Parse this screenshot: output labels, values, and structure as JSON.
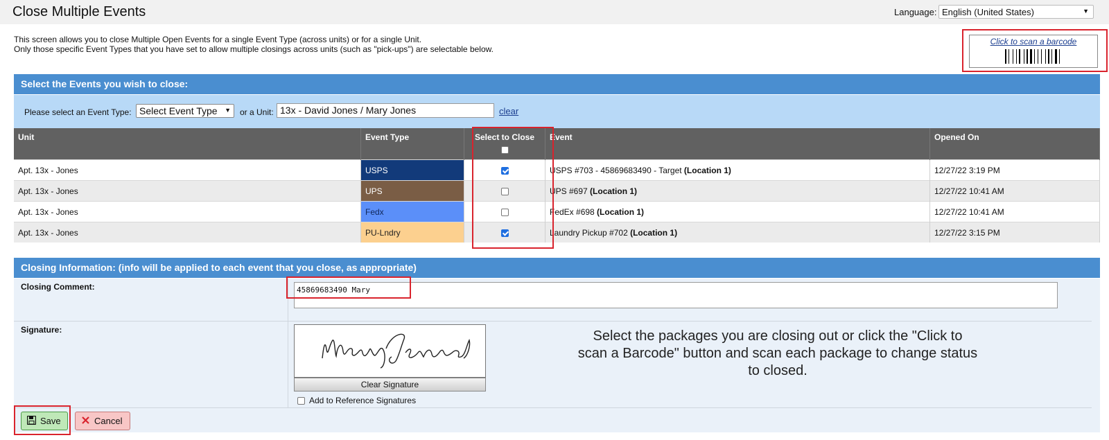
{
  "header": {
    "title": "Close Multiple Events",
    "language_label": "Language:",
    "language_value": "English (United States)"
  },
  "intro": {
    "line1": "This screen allows you to close Multiple Open Events for a single Event Type (across units) or for a single Unit.",
    "line2": "Only those specific Event Types that you have set to allow multiple closings across units (such as \"pick-ups\") are selectable below."
  },
  "barcode": {
    "label": "Click to scan a barcode"
  },
  "events_section": {
    "title": "Select the Events you wish to close:",
    "event_type_label": "Please select an Event Type:",
    "event_type_value": "Select Event Type",
    "unit_label": "or a Unit:",
    "unit_value": "13x - David Jones / Mary Jones",
    "clear_label": "clear",
    "columns": {
      "unit": "Unit",
      "event_type": "Event Type",
      "select": "Select to Close",
      "event": "Event",
      "opened": "Opened On"
    },
    "rows": [
      {
        "unit": "Apt. 13x - Jones",
        "event_type": "USPS",
        "type_color": "#123a7a",
        "type_text_color": "#ffffff",
        "checked": true,
        "event": "USPS #703 - 45869683490 - Target ",
        "location": "(Location 1)",
        "opened": "12/27/22 3:19 PM"
      },
      {
        "unit": "Apt. 13x - Jones",
        "event_type": "UPS",
        "type_color": "#7a5d45",
        "type_text_color": "#ffffff",
        "checked": false,
        "event": "UPS #697 ",
        "location": "(Location 1)",
        "opened": "12/27/22 10:41 AM"
      },
      {
        "unit": "Apt. 13x - Jones",
        "event_type": "Fedx",
        "type_color": "#5b8ff9",
        "type_text_color": "#10275a",
        "checked": false,
        "event": "FedEx #698 ",
        "location": "(Location 1)",
        "opened": "12/27/22 10:41 AM"
      },
      {
        "unit": "Apt. 13x - Jones",
        "event_type": "PU-Lndry",
        "type_color": "#fcd08f",
        "type_text_color": "#222222",
        "checked": true,
        "event": "Laundry Pickup #702 ",
        "location": "(Location 1)",
        "opened": "12/27/22 3:15 PM"
      }
    ]
  },
  "closing": {
    "title": "Closing Information: (info will be applied to each event that you close, as appropriate)",
    "comment_label": "Closing Comment:",
    "comment_value": "45869683490 Mary",
    "signature_label": "Signature:",
    "clear_signature": "Clear Signature",
    "add_reference": "Add to Reference Signatures"
  },
  "note": "Select the packages you are closing out or click the \"Click to scan a Barcode\" button and scan each package to change status to closed.",
  "buttons": {
    "save": "Save",
    "cancel": "Cancel"
  },
  "icons": {
    "save": "floppy-disk-icon",
    "cancel": "x-icon",
    "dropdown": "chevron-down-icon"
  }
}
